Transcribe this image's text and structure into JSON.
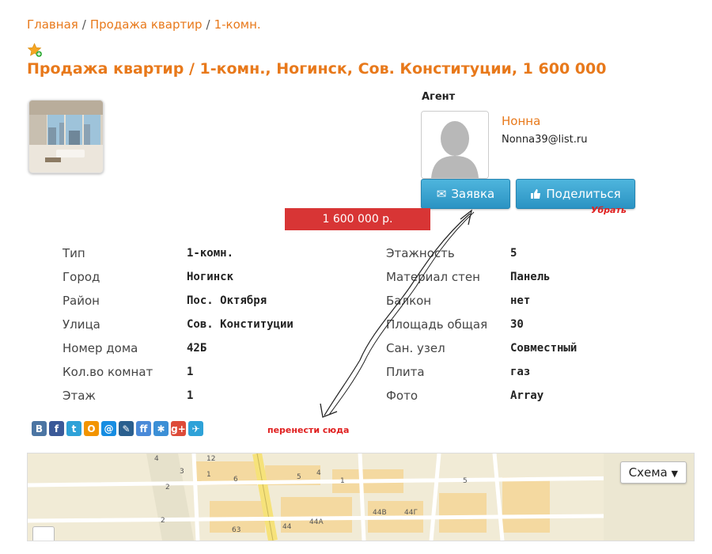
{
  "breadcrumb": [
    "Главная",
    "Продажа квартир",
    "1-комн."
  ],
  "title": "Продажа квартир / 1-комн., Ногинск, Сов. Конституции, 1 600 000",
  "agent": {
    "label": "Агент",
    "name": "Нонна",
    "email": "Nonna39@list.ru"
  },
  "buttons": {
    "request": "Заявка",
    "share": "Поделиться"
  },
  "price": "1 600 000 р.",
  "annotations": {
    "remove": "Убрать",
    "move_here": "перенести сюда"
  },
  "properties_left": [
    {
      "label": "Тип",
      "value": "1-комн."
    },
    {
      "label": "Город",
      "value": "Ногинск"
    },
    {
      "label": "Район",
      "value": "Пос. Октября"
    },
    {
      "label": "Улица",
      "value": "Сов. Конституции"
    },
    {
      "label": "Номер дома",
      "value": "42Б"
    },
    {
      "label": "Кол.во комнат",
      "value": "1"
    },
    {
      "label": "Этаж",
      "value": "1"
    }
  ],
  "properties_right": [
    {
      "label": "Этажность",
      "value": "5"
    },
    {
      "label": "Материал стен",
      "value": "Панель"
    },
    {
      "label": "Балкон",
      "value": "нет"
    },
    {
      "label": "Площадь общая",
      "value": "30"
    },
    {
      "label": "Сан. узел",
      "value": "Совместный"
    },
    {
      "label": "Плита",
      "value": "газ"
    },
    {
      "label": "Фото",
      "value": "Array"
    }
  ],
  "social": [
    {
      "name": "vk",
      "glyph": "В",
      "color": "#4c75a3"
    },
    {
      "name": "facebook",
      "glyph": "f",
      "color": "#3b5998"
    },
    {
      "name": "twitter",
      "glyph": "t",
      "color": "#2ea2d8"
    },
    {
      "name": "odnoklassniki",
      "glyph": "О",
      "color": "#f29400"
    },
    {
      "name": "mail",
      "glyph": "@",
      "color": "#168de2"
    },
    {
      "name": "livejournal",
      "glyph": "✎",
      "color": "#2a5f8e"
    },
    {
      "name": "friendfeed",
      "glyph": "ff",
      "color": "#4a8ad8"
    },
    {
      "name": "liveinternet",
      "glyph": "✱",
      "color": "#3b8fd6"
    },
    {
      "name": "google-plus",
      "glyph": "g+",
      "color": "#dd4b39"
    },
    {
      "name": "moi-krug",
      "glyph": "✈",
      "color": "#2ea2d8"
    }
  ],
  "map": {
    "type_button": "Схема",
    "labels": [
      "4",
      "3",
      "2",
      "1",
      "6",
      "5",
      "4",
      "2",
      "63",
      "44",
      "44А",
      "44В",
      "44Г",
      "12",
      "1",
      "5"
    ]
  }
}
